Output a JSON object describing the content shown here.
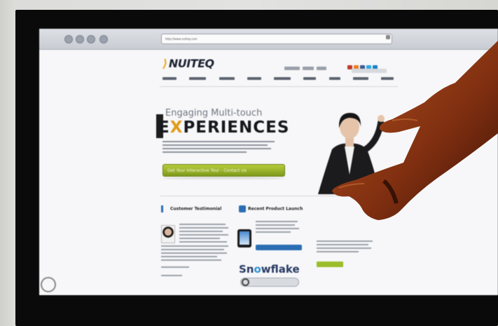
{
  "browser": {
    "url": "http://www.nuiteq.com"
  },
  "site": {
    "logo": "NUITEQ",
    "hero_line1": "Engaging Multi-touch",
    "hero_line2_prefix": "E",
    "hero_line2_accent": "X",
    "hero_line2_suffix": "PERIENCES",
    "cta_label": "Get Your Interactive Tour - Contact Us",
    "col1_title": "Customer Testimonial",
    "col2_title": "Recent Product Launch",
    "snowflake_prefix": "Sn",
    "snowflake_accent": "o",
    "snowflake_suffix": "wflake"
  },
  "colors": {
    "accent_orange": "#e09a16",
    "cta_green": "#9bbd2a",
    "brand_blue": "#2b6db2",
    "bezel": "#0a0a0a",
    "skin": "#a4441c"
  }
}
